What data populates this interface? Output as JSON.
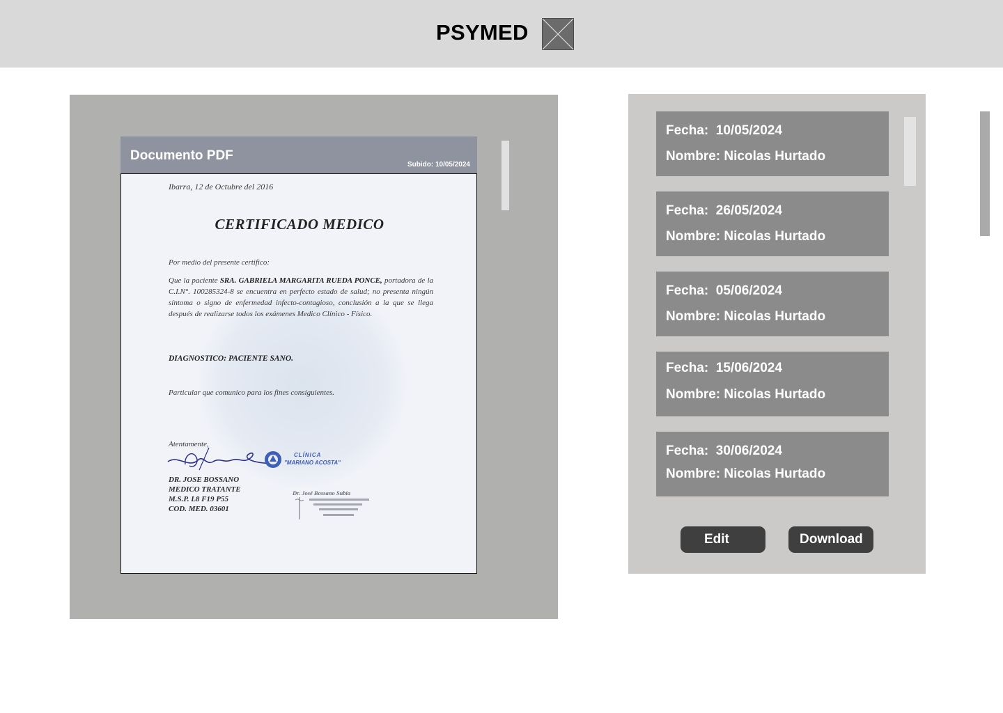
{
  "header": {
    "brand": "PSYMED",
    "logo_icon": "image-placeholder-icon",
    "background": "#d9d9d9"
  },
  "viewer": {
    "doc_title": "Documento PDF",
    "uploaded": "Subido: 10/05/2024",
    "document": {
      "place_date": "Ibarra, 12  de Octubre  del 2016",
      "title": "CERTIFICADO MEDICO",
      "intro": "Por medio del presente certifico:",
      "body_prefix": "Que  la  paciente ",
      "patient": "SRA.  GABRIELA  MARGARITA  RUEDA  PONCE,",
      "body_rest": " portadora de la C.I.N°. 100285324-8 se encuentra en perfecto estado de salud; no presenta ningún síntoma o signo de enfermedad infecto-contagioso, conclusión a la que se llega después de realizarse todos los exámenes Medico Clínico - Físico.",
      "diagnosis": "DIAGNOSTICO: PACIENTE SANO.",
      "closing": "Particular que comunico para los fines consiguientes.",
      "regards": "Atentamente,",
      "doctor_lines": [
        "DR. JOSE BOSSANO",
        "MEDICO TRATANTE",
        "M.S.P. L8 F19 P55",
        "COD. MED. 03601"
      ],
      "seal_text_1": "CLÍNICA",
      "seal_text_2": "\"MARIANO ACOSTA\"",
      "stamp_name": "Dr. José Bossano Subía"
    }
  },
  "records": {
    "items": [
      {
        "fecha": "Fecha:  10/05/2024",
        "nombre": "Nombre: Nicolas Hurtado"
      },
      {
        "fecha": "Fecha:  26/05/2024",
        "nombre": "Nombre: Nicolas Hurtado"
      },
      {
        "fecha": "Fecha:  05/06/2024",
        "nombre": "Nombre: Nicolas Hurtado"
      },
      {
        "fecha": "Fecha:  15/06/2024",
        "nombre": "Nombre: Nicolas Hurtado"
      },
      {
        "fecha": "Fecha:  30/06/2024",
        "nombre": "Nombre: Nicolas Hurtado"
      }
    ],
    "edit_label": "Edit",
    "download_label": "Download"
  },
  "colors": {
    "panel_gray": "#b0b0af",
    "records_bg": "#cbcac8",
    "record_card": "#8b8b8b",
    "button_dark": "#3f3f3f",
    "doc_header": "#8f93a0"
  }
}
